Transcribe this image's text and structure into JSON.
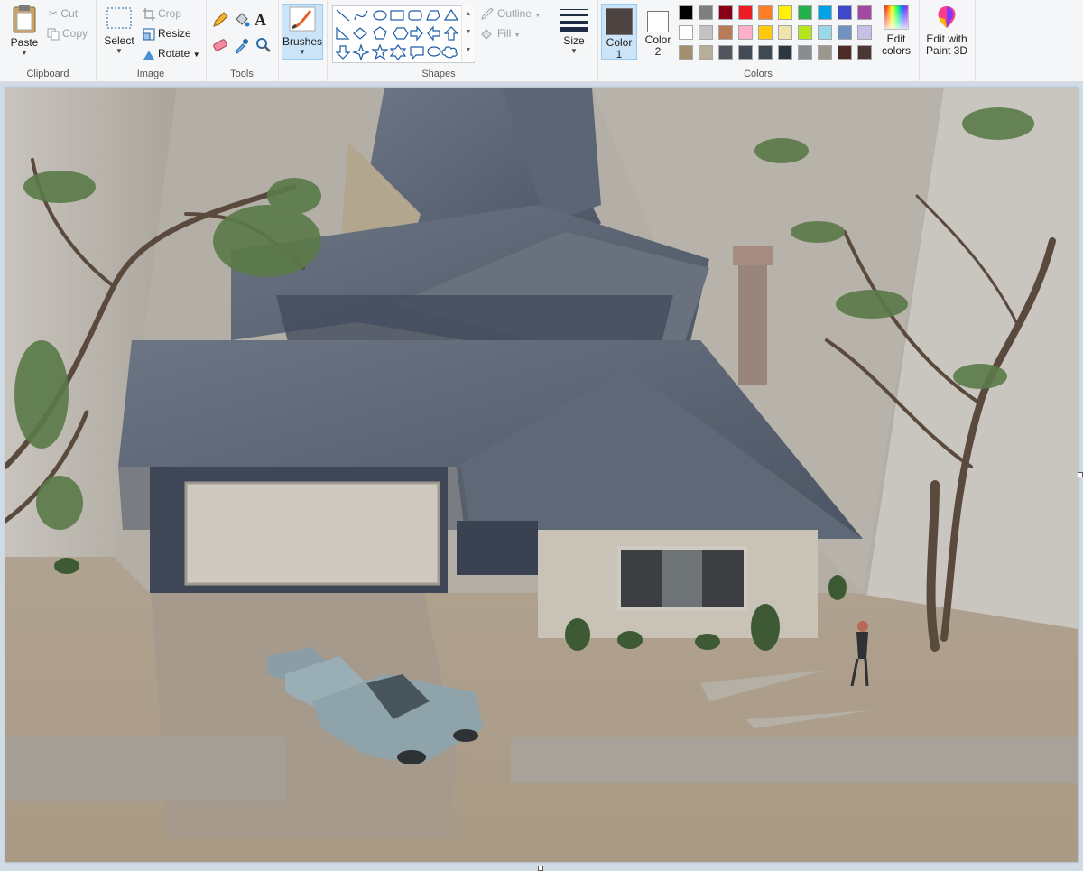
{
  "clipboard": {
    "paste": "Paste",
    "cut": "Cut",
    "copy": "Copy",
    "label": "Clipboard"
  },
  "image": {
    "select": "Select",
    "crop": "Crop",
    "resize": "Resize",
    "rotate": "Rotate",
    "label": "Image"
  },
  "tools": {
    "label": "Tools"
  },
  "brushes": {
    "label": "Brushes"
  },
  "shapes": {
    "outline": "Outline",
    "fill": "Fill",
    "label": "Shapes"
  },
  "size": {
    "label": "Size"
  },
  "colors": {
    "color1": "Color 1",
    "color2": "Color 2",
    "edit": "Edit colors",
    "label": "Colors",
    "color1_value": "#4d4341",
    "color2_value": "#ffffff",
    "palette_row1": [
      "#000000",
      "#7f7f7f",
      "#880015",
      "#ed1c24",
      "#ff7f27",
      "#fff200",
      "#22b14c",
      "#00a2e8",
      "#3f48cc",
      "#a349a4"
    ],
    "palette_row2": [
      "#ffffff",
      "#c3c3c3",
      "#b97a57",
      "#ffaec9",
      "#ffc90e",
      "#efe4b0",
      "#b5e61d",
      "#99d9ea",
      "#7092be",
      "#c8bfe7"
    ],
    "palette_row3": [
      "#a38f6e",
      "#b6ad9a",
      "#52565c",
      "#424a54",
      "#3f4954",
      "#2b3640",
      "#8a8d90",
      "#9c978d",
      "#4e2b26",
      "#4a3733"
    ]
  },
  "paint3d": {
    "label": "Edit with Paint 3D"
  }
}
